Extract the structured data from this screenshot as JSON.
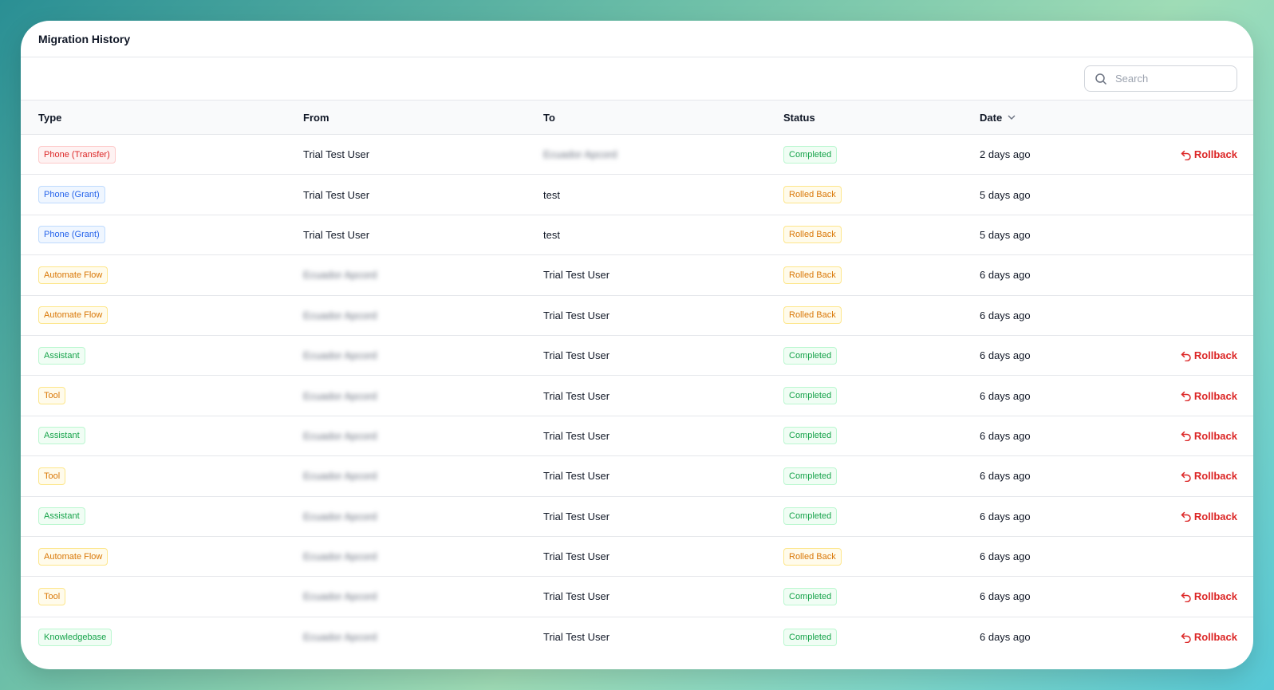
{
  "title": "Migration History",
  "search": {
    "placeholder": "Search"
  },
  "columns": {
    "type": "Type",
    "from": "From",
    "to": "To",
    "status": "Status",
    "date": "Date"
  },
  "rollback_label": "Rollback",
  "badge_styles": {
    "Phone (Transfer)": {
      "color": "#dc2626",
      "bg": "#fef2f2",
      "border": "#fecaca"
    },
    "Phone (Grant)": {
      "color": "#2563eb",
      "bg": "#eff6ff",
      "border": "#bfdbfe"
    },
    "Automate Flow": {
      "color": "#d97706",
      "bg": "#fffbeb",
      "border": "#fde68a"
    },
    "Assistant": {
      "color": "#16a34a",
      "bg": "#f0fdf4",
      "border": "#bbf7d0"
    },
    "Tool": {
      "color": "#d97706",
      "bg": "#fffbeb",
      "border": "#fde68a"
    },
    "Knowledgebase": {
      "color": "#16a34a",
      "bg": "#f0fdf4",
      "border": "#bbf7d0"
    },
    "Completed": {
      "color": "#16a34a",
      "bg": "#f0fdf4",
      "border": "#bbf7d0"
    },
    "Rolled Back": {
      "color": "#d97706",
      "bg": "#fffbeb",
      "border": "#fde68a"
    }
  },
  "rows": [
    {
      "type": "Phone (Transfer)",
      "from": "Trial Test User",
      "from_blur": false,
      "to": "Ecuador Apcord",
      "to_blur": true,
      "status": "Completed",
      "date": "2 days ago",
      "rollback": true
    },
    {
      "type": "Phone (Grant)",
      "from": "Trial Test User",
      "from_blur": false,
      "to": "test",
      "to_blur": false,
      "status": "Rolled Back",
      "date": "5 days ago",
      "rollback": false
    },
    {
      "type": "Phone (Grant)",
      "from": "Trial Test User",
      "from_blur": false,
      "to": "test",
      "to_blur": false,
      "status": "Rolled Back",
      "date": "5 days ago",
      "rollback": false
    },
    {
      "type": "Automate Flow",
      "from": "Ecuador Apcord",
      "from_blur": true,
      "to": "Trial Test User",
      "to_blur": false,
      "status": "Rolled Back",
      "date": "6 days ago",
      "rollback": false
    },
    {
      "type": "Automate Flow",
      "from": "Ecuador Apcord",
      "from_blur": true,
      "to": "Trial Test User",
      "to_blur": false,
      "status": "Rolled Back",
      "date": "6 days ago",
      "rollback": false
    },
    {
      "type": "Assistant",
      "from": "Ecuador Apcord",
      "from_blur": true,
      "to": "Trial Test User",
      "to_blur": false,
      "status": "Completed",
      "date": "6 days ago",
      "rollback": true
    },
    {
      "type": "Tool",
      "from": "Ecuador Apcord",
      "from_blur": true,
      "to": "Trial Test User",
      "to_blur": false,
      "status": "Completed",
      "date": "6 days ago",
      "rollback": true
    },
    {
      "type": "Assistant",
      "from": "Ecuador Apcord",
      "from_blur": true,
      "to": "Trial Test User",
      "to_blur": false,
      "status": "Completed",
      "date": "6 days ago",
      "rollback": true
    },
    {
      "type": "Tool",
      "from": "Ecuador Apcord",
      "from_blur": true,
      "to": "Trial Test User",
      "to_blur": false,
      "status": "Completed",
      "date": "6 days ago",
      "rollback": true
    },
    {
      "type": "Assistant",
      "from": "Ecuador Apcord",
      "from_blur": true,
      "to": "Trial Test User",
      "to_blur": false,
      "status": "Completed",
      "date": "6 days ago",
      "rollback": true
    },
    {
      "type": "Automate Flow",
      "from": "Ecuador Apcord",
      "from_blur": true,
      "to": "Trial Test User",
      "to_blur": false,
      "status": "Rolled Back",
      "date": "6 days ago",
      "rollback": false
    },
    {
      "type": "Tool",
      "from": "Ecuador Apcord",
      "from_blur": true,
      "to": "Trial Test User",
      "to_blur": false,
      "status": "Completed",
      "date": "6 days ago",
      "rollback": true
    },
    {
      "type": "Knowledgebase",
      "from": "Ecuador Apcord",
      "from_blur": true,
      "to": "Trial Test User",
      "to_blur": false,
      "status": "Completed",
      "date": "6 days ago",
      "rollback": true
    }
  ]
}
